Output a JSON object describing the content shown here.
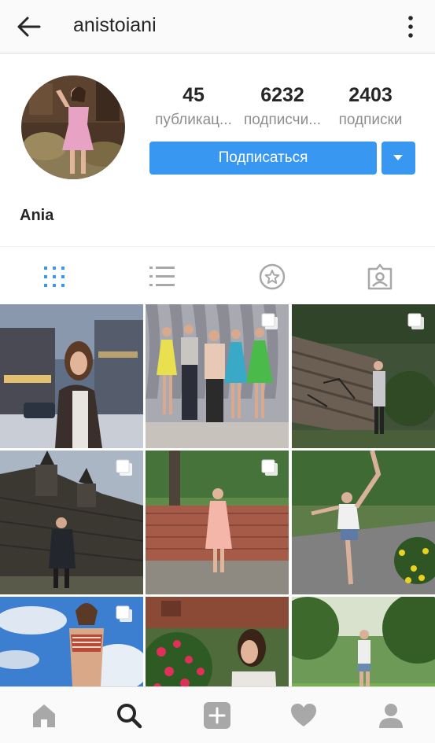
{
  "header": {
    "username": "anistoiani",
    "back_icon": "arrow-left-icon",
    "more_icon": "more-vertical-icon"
  },
  "profile": {
    "full_name": "Ania",
    "stats": [
      {
        "value": "45",
        "label": "публикац..."
      },
      {
        "value": "6232",
        "label": "подписчи..."
      },
      {
        "value": "2403",
        "label": "подписки"
      }
    ],
    "follow_label": "Подписаться"
  },
  "tabs": [
    {
      "icon": "grid-icon",
      "active": true
    },
    {
      "icon": "list-icon",
      "active": false
    },
    {
      "icon": "star-circle-icon",
      "active": false
    },
    {
      "icon": "tagged-person-icon",
      "active": false
    }
  ],
  "posts": [
    {
      "scene": "city-street-girl-fur",
      "multi": false
    },
    {
      "scene": "ballet-group",
      "multi": true
    },
    {
      "scene": "wooden-fence",
      "multi": true
    },
    {
      "scene": "castle-wall",
      "multi": true
    },
    {
      "scene": "garden-pink-dress",
      "multi": true
    },
    {
      "scene": "park-high-kick",
      "multi": false
    },
    {
      "scene": "sky-striped-top",
      "multi": true
    },
    {
      "scene": "red-flowers",
      "multi": false
    },
    {
      "scene": "green-meadow",
      "multi": false
    }
  ],
  "bottom_nav": [
    {
      "icon": "home-icon",
      "active": false
    },
    {
      "icon": "search-icon",
      "active": true
    },
    {
      "icon": "add-icon",
      "active": false
    },
    {
      "icon": "heart-icon",
      "active": false
    },
    {
      "icon": "profile-icon",
      "active": false
    }
  ],
  "colors": {
    "accent": "#3897f0",
    "text": "#262626",
    "muted": "#8e8e8e",
    "icon_inactive": "#a8a8a8"
  }
}
